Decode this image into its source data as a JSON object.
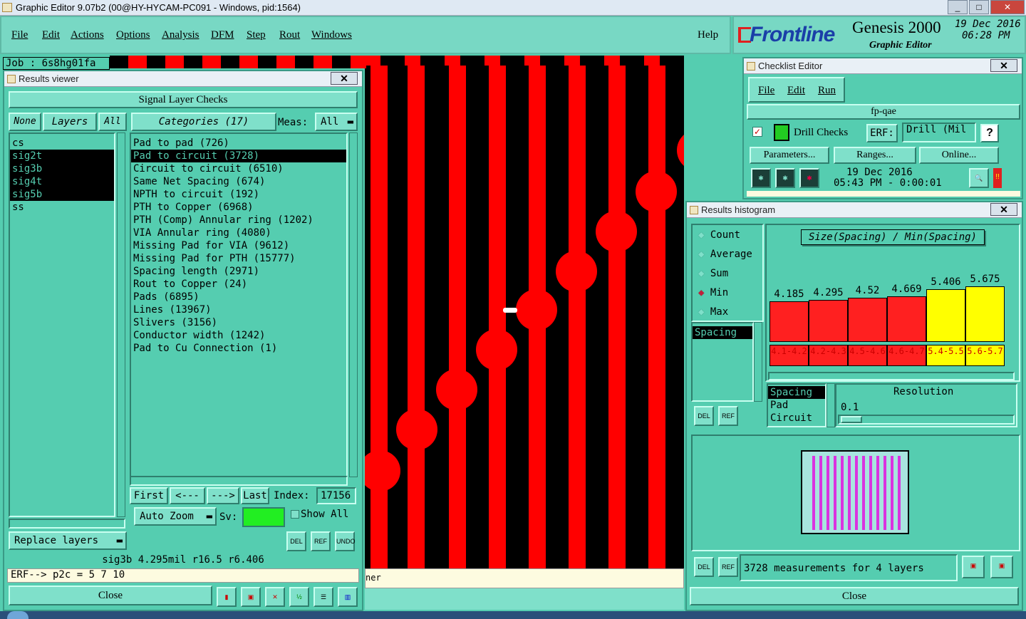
{
  "window": {
    "title": "Graphic Editor 9.07b2 (00@HY-HYCAM-PC091 - Windows, pid:1564)"
  },
  "menu": {
    "items": [
      "File",
      "Edit",
      "Actions",
      "Options",
      "Analysis",
      "DFM",
      "Step",
      "Rout",
      "Windows"
    ],
    "help": "Help"
  },
  "brand": {
    "logo": "Frontline",
    "product": "Genesis 2000",
    "subtitle": "Graphic Editor",
    "date": "19 Dec 2016",
    "time": "06:28 PM"
  },
  "job": {
    "label": "Job : 6s8hg01fa"
  },
  "results_viewer": {
    "title": "Results viewer",
    "header": "Signal Layer Checks",
    "none_btn": "None",
    "layers_btn": "Layers",
    "all_btn": "All",
    "layers": [
      {
        "name": "cs",
        "selected": false
      },
      {
        "name": "sig2t",
        "selected": true
      },
      {
        "name": "sig3b",
        "selected": true
      },
      {
        "name": "sig4t",
        "selected": true
      },
      {
        "name": "sig5b",
        "selected": true
      },
      {
        "name": "ss",
        "selected": false
      }
    ],
    "categories_btn": "Categories (17)",
    "meas_label": "Meas:",
    "meas_value": "All",
    "categories": [
      {
        "label": "Pad to pad (726)",
        "selected": false
      },
      {
        "label": "Pad to circuit (3728)",
        "selected": true
      },
      {
        "label": "Circuit to circuit (6510)",
        "selected": false
      },
      {
        "label": "Same Net Spacing (674)",
        "selected": false
      },
      {
        "label": "NPTH to circuit (192)",
        "selected": false
      },
      {
        "label": "PTH to Copper (6968)",
        "selected": false
      },
      {
        "label": "PTH (Comp) Annular ring (1202)",
        "selected": false
      },
      {
        "label": "VIA Annular ring (4080)",
        "selected": false
      },
      {
        "label": "Missing Pad for VIA (9612)",
        "selected": false
      },
      {
        "label": "Missing Pad for PTH (15777)",
        "selected": false
      },
      {
        "label": "Spacing length (2971)",
        "selected": false
      },
      {
        "label": "Rout to Copper (24)",
        "selected": false
      },
      {
        "label": "Pads (6895)",
        "selected": false
      },
      {
        "label": "Lines (13967)",
        "selected": false
      },
      {
        "label": "Slivers (3156)",
        "selected": false
      },
      {
        "label": "Conductor width (1242)",
        "selected": false
      },
      {
        "label": "Pad to Cu Connection (1)",
        "selected": false
      }
    ],
    "nav": {
      "first": "First",
      "prev": "<---",
      "next": "--->",
      "last": "Last",
      "index_label": "Index:",
      "index_value": "17156"
    },
    "auto_zoom": "Auto Zoom",
    "sv_label": "Sv:",
    "show_all": "Show All",
    "replace_layers": "Replace layers",
    "tools": {
      "del": "DEL",
      "ref": "REF",
      "undo": "UNDO"
    },
    "status": "sig3b 4.295mil  r16.5  r6.406",
    "erf_line": "ERF--> p2c = 5 7 10",
    "close": "Close"
  },
  "checklist_editor": {
    "title": "Checklist Editor",
    "menu": [
      "File",
      "Edit",
      "Run"
    ],
    "name": "fp-qae",
    "check_name": "Drill Checks",
    "erf_label": "ERF:",
    "erf_value": "Drill (Mil",
    "help": "?",
    "buttons": [
      "Parameters...",
      "Ranges...",
      "Online..."
    ],
    "run_date": "19 Dec 2016",
    "run_time": "05:43 PM - 0:00:01",
    "warn": "!!"
  },
  "results_histogram": {
    "title": "Results histogram",
    "modes": [
      {
        "label": "Count",
        "selected": false
      },
      {
        "label": "Average",
        "selected": false
      },
      {
        "label": "Sum",
        "selected": false
      },
      {
        "label": "Min",
        "selected": true
      },
      {
        "label": "Max",
        "selected": false
      }
    ],
    "chart_title": "Size(Spacing) / Min(Spacing)",
    "bins": [
      {
        "value": "4.185",
        "range": "4.1-4.2",
        "color": "#ff2020",
        "level": 0.737
      },
      {
        "value": "4.295",
        "range": "4.2-4.3",
        "color": "#ff2020",
        "level": 0.757
      },
      {
        "value": "4.52",
        "range": "4.5-4.6",
        "color": "#ff2020",
        "level": 0.796
      },
      {
        "value": "4.669",
        "range": "4.6-4.7",
        "color": "#ff2020",
        "level": 0.823
      },
      {
        "value": "5.406",
        "range": "5.4-5.5",
        "color": "#ffff00",
        "level": 0.953
      },
      {
        "value": "5.675",
        "range": "5.6-5.7",
        "color": "#ffff00",
        "level": 1.0
      }
    ],
    "list_left": [
      "Spacing"
    ],
    "list_types": [
      {
        "label": "Spacing",
        "selected": true
      },
      {
        "label": "Pad",
        "selected": false
      },
      {
        "label": "Circuit",
        "selected": false
      }
    ],
    "resolution_label": "Resolution",
    "resolution_value": "0.1",
    "summary": "3728 measurements for 4 layers",
    "close": "Close"
  },
  "canvas": {
    "status_fragment": "ner"
  }
}
